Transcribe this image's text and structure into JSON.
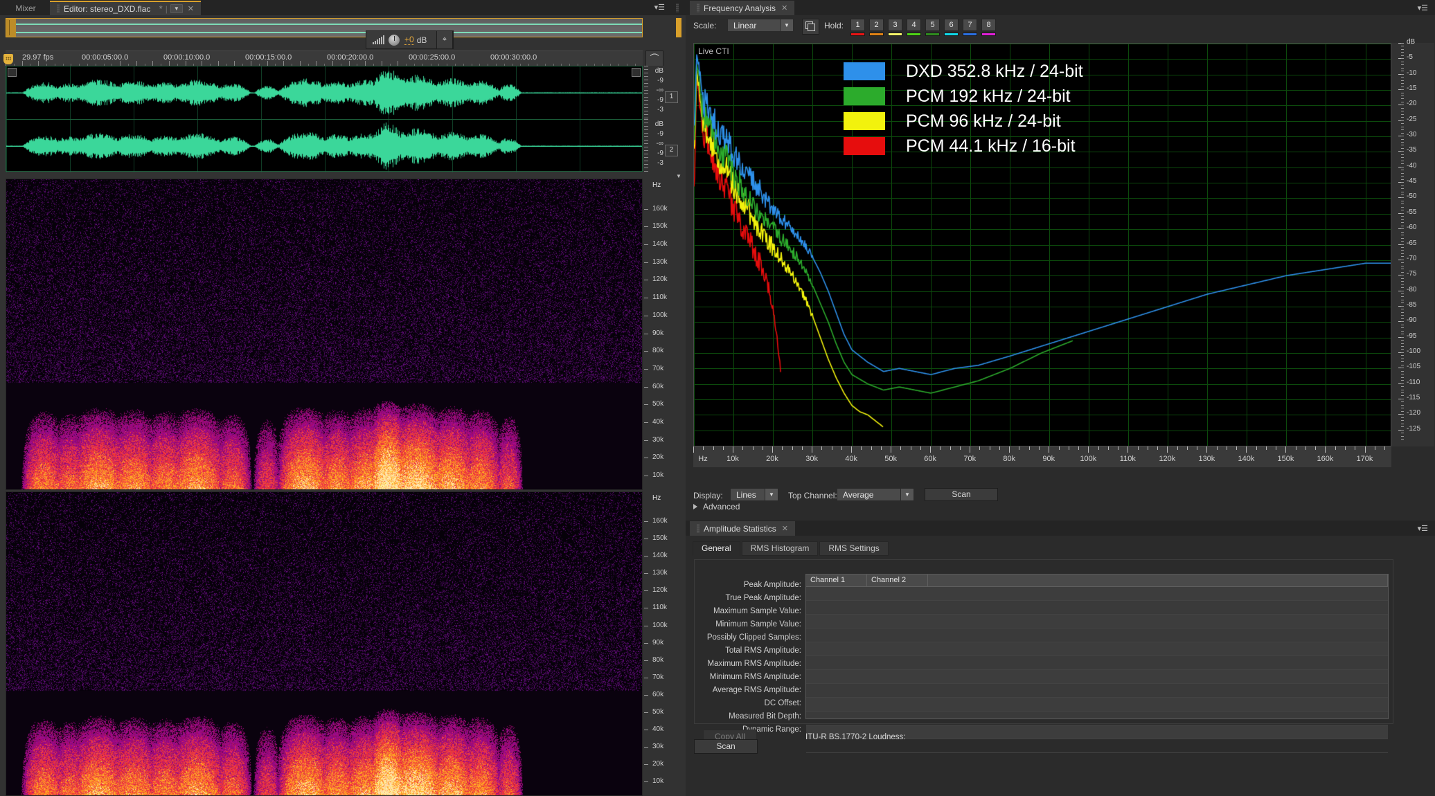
{
  "editor": {
    "tabs": [
      {
        "label": "Mixer",
        "active": false
      },
      {
        "label": "Editor: stereo_DXD.flac",
        "active": true,
        "modified_mark": "*",
        "caret": "▼",
        "close": "✕"
      }
    ],
    "panel_menu_icon": "panel-menu-icon",
    "gain": {
      "value": "+0",
      "unit": "dB"
    },
    "ruler": {
      "fps": "29.97 fps",
      "timecodes": [
        {
          "label": "00:00:05:00.0",
          "x": 150
        },
        {
          "label": "00:00:10:00.0",
          "x": 268
        },
        {
          "label": "00:00:15:00.0",
          "x": 386
        },
        {
          "label": "00:00:20:00.0",
          "x": 504
        },
        {
          "label": "00:00:25:00.0",
          "x": 622
        },
        {
          "label": "00:00:30:00.0",
          "x": 740
        }
      ]
    },
    "snap_icon": "magnet-icon",
    "waveform": {
      "db_title": "dB",
      "db_ticks": [
        "-9",
        "-∞",
        "-9",
        "-3"
      ],
      "channels": [
        {
          "badge": "1"
        },
        {
          "badge": "2"
        }
      ]
    },
    "spectrogram": {
      "hz_title": "Hz",
      "hz_ticks": [
        "160k",
        "150k",
        "140k",
        "130k",
        "120k",
        "110k",
        "100k",
        "90k",
        "80k",
        "70k",
        "60k",
        "50k",
        "40k",
        "30k",
        "20k",
        "10k"
      ]
    }
  },
  "frequency_analysis": {
    "tab_label": "Frequency Analysis",
    "tab_close": "✕",
    "menu_icon": "panel-menu-icon",
    "scale_label": "Scale:",
    "scale_value": "Linear",
    "copy_icon": "copy-icon",
    "hold_label": "Hold:",
    "hold_buttons": [
      {
        "label": "1",
        "color": "#e81414"
      },
      {
        "label": "2",
        "color": "#e08214"
      },
      {
        "label": "3",
        "color": "#f5f56a"
      },
      {
        "label": "4",
        "color": "#4ed416"
      },
      {
        "label": "5",
        "color": "#2e8b1e"
      },
      {
        "label": "6",
        "color": "#0fd8e8"
      },
      {
        "label": "7",
        "color": "#2a6fe0"
      },
      {
        "label": "8",
        "color": "#e01fd8"
      }
    ],
    "graph_label": "Live CTI",
    "display_label": "Display:",
    "display_value": "Lines",
    "top_channel_label": "Top Channel:",
    "top_channel_value": "Average",
    "scan_label": "Scan",
    "advanced_label": "Advanced"
  },
  "chart_data": {
    "type": "line",
    "title": "Live CTI",
    "xlabel": "Hz",
    "ylabel": "dB",
    "xlim": [
      0,
      176400
    ],
    "ylim": [
      -130,
      0
    ],
    "grid": true,
    "legend_position": "top-center",
    "x_ticks": [
      "Hz",
      "10k",
      "20k",
      "30k",
      "40k",
      "50k",
      "60k",
      "70k",
      "80k",
      "90k",
      "100k",
      "110k",
      "120k",
      "130k",
      "140k",
      "150k",
      "160k",
      "170k"
    ],
    "y_ticks": [
      "dB",
      "-5",
      "-10",
      "-15",
      "-20",
      "-25",
      "-30",
      "-35",
      "-40",
      "-45",
      "-50",
      "-55",
      "-60",
      "-65",
      "-70",
      "-75",
      "-80",
      "-85",
      "-90",
      "-95",
      "-100",
      "-105",
      "-110",
      "-115",
      "-120",
      "-125"
    ],
    "series": [
      {
        "name": "DXD 352.8 kHz / 24-bit",
        "color": "#2e90ea",
        "x": [
          200,
          600,
          1200,
          1800,
          2600,
          3400,
          4200,
          5000,
          6000,
          7000,
          8000,
          9000,
          10000,
          11500,
          13000,
          14500,
          16000,
          18000,
          20000,
          22000,
          24000,
          26000,
          28000,
          30000,
          32000,
          34000,
          36000,
          38000,
          40000,
          44000,
          48000,
          52000,
          56000,
          60000,
          66000,
          72000,
          80000,
          90000,
          100000,
          110000,
          120000,
          130000,
          140000,
          150000,
          160000,
          170000,
          176400
        ],
        "y": [
          -26,
          -5,
          -6,
          -14,
          -20,
          -21,
          -24,
          -26,
          -27,
          -30,
          -32,
          -33,
          -36,
          -38,
          -41,
          -44,
          -46,
          -50,
          -53,
          -56,
          -59,
          -62,
          -65,
          -69,
          -74,
          -80,
          -87,
          -94,
          -99,
          -103,
          -106,
          -105,
          -106,
          -107,
          -105,
          -104,
          -101,
          -97,
          -93,
          -89,
          -85,
          -81,
          -78,
          -75,
          -73,
          -71,
          -71
        ]
      },
      {
        "name": "PCM 192 kHz / 24-bit",
        "color": "#2cab2c",
        "x": [
          200,
          600,
          1200,
          1800,
          2600,
          3400,
          4200,
          5000,
          6000,
          7000,
          8000,
          9000,
          10000,
          11500,
          13000,
          14500,
          16000,
          18000,
          20000,
          22000,
          24000,
          26000,
          28000,
          30000,
          32000,
          34000,
          36000,
          38000,
          40000,
          44000,
          48000,
          52000,
          56000,
          60000,
          66000,
          72000,
          80000,
          88000,
          94000,
          96000
        ],
        "y": [
          -30,
          -8,
          -10,
          -18,
          -23,
          -25,
          -28,
          -30,
          -32,
          -35,
          -37,
          -39,
          -42,
          -45,
          -48,
          -51,
          -54,
          -57,
          -60,
          -63,
          -66,
          -69,
          -73,
          -78,
          -84,
          -90,
          -97,
          -103,
          -107,
          -110,
          -112,
          -111,
          -112,
          -113,
          -111,
          -109,
          -105,
          -100,
          -97,
          -96
        ]
      },
      {
        "name": "PCM 96 kHz / 24-bit",
        "color": "#f2f20d",
        "x": [
          200,
          600,
          1200,
          1800,
          2600,
          3400,
          4200,
          5000,
          6000,
          7000,
          8000,
          9000,
          10000,
          11500,
          13000,
          14500,
          16000,
          18000,
          20000,
          22000,
          24000,
          26000,
          28000,
          30000,
          32000,
          34000,
          36000,
          38000,
          40000,
          42000,
          44000,
          46000,
          48000
        ],
        "y": [
          -33,
          -10,
          -13,
          -21,
          -26,
          -28,
          -31,
          -33,
          -36,
          -39,
          -41,
          -43,
          -46,
          -49,
          -52,
          -56,
          -59,
          -62,
          -66,
          -69,
          -73,
          -77,
          -82,
          -88,
          -95,
          -102,
          -108,
          -113,
          -117,
          -119,
          -120,
          -122,
          -124
        ]
      },
      {
        "name": "PCM 44.1 kHz / 16-bit",
        "color": "#e60d0d",
        "x": [
          200,
          600,
          1200,
          1800,
          2600,
          3400,
          4200,
          5000,
          6000,
          7000,
          8000,
          9000,
          10000,
          11500,
          13000,
          14500,
          16000,
          17000,
          18000,
          19000,
          20000,
          20500,
          21000,
          21500,
          22050
        ],
        "y": [
          -45,
          -12,
          -16,
          -24,
          -29,
          -32,
          -35,
          -38,
          -41,
          -44,
          -47,
          -50,
          -53,
          -57,
          -61,
          -65,
          -69,
          -72,
          -76,
          -80,
          -85,
          -90,
          -95,
          -100,
          -106
        ]
      }
    ]
  },
  "amplitude_statistics": {
    "tab_label": "Amplitude Statistics",
    "tab_close": "✕",
    "menu_icon": "panel-menu-icon",
    "subtabs": [
      {
        "label": "General",
        "active": true
      },
      {
        "label": "RMS Histogram",
        "active": false
      },
      {
        "label": "RMS Settings",
        "active": false
      }
    ],
    "columns": [
      "Channel 1",
      "Channel 2"
    ],
    "rows": [
      "Peak Amplitude:",
      "True Peak Amplitude:",
      "Maximum Sample Value:",
      "Minimum Sample Value:",
      "Possibly Clipped Samples:",
      "Total RMS Amplitude:",
      "Maximum RMS Amplitude:",
      "Minimum RMS Amplitude:",
      "Average RMS Amplitude:",
      "DC Offset:",
      "Measured Bit Depth:",
      "Dynamic Range:"
    ],
    "copy_all_label": "Copy All",
    "loudness_label": "ITU-R BS.1770-2 Loudness:",
    "scan_label": "Scan"
  }
}
